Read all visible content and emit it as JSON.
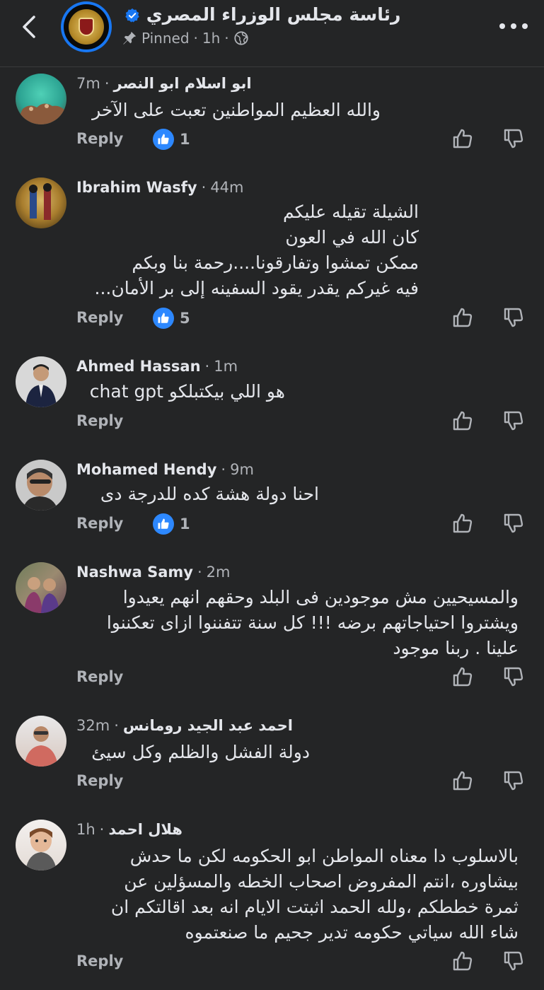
{
  "header": {
    "page_name": "رئاسة مجلس الوزراء المصري",
    "pinned_label": "Pinned",
    "time": "1h",
    "icons": {
      "back": "back-chevron-icon",
      "verified": "verified-badge-icon",
      "pin": "pin-icon",
      "globe": "globe-icon",
      "more": "more-dots-icon"
    }
  },
  "ui": {
    "reply_label": "Reply",
    "like_color": "#2d88ff"
  },
  "comments": [
    {
      "author": "ابو اسلام ابو النصر",
      "time": "7m",
      "text": [
        "والله العظيم المواطنين تعبت على الآخر"
      ],
      "reactions": "1"
    },
    {
      "author": "Ibrahim Wasfy",
      "time": "44m",
      "text": [
        "الشيلة تقيله عليكم",
        "كان الله في العون",
        "ممكن تمشوا وتفارقونا....رحمة بنا وبكم",
        "فيه غيركم يقدر يقود السفينه إلى بر الأمان..."
      ],
      "reactions": "5"
    },
    {
      "author": "Ahmed Hassan",
      "time": "1m",
      "text": [
        "هو اللي بيكتبلكو chat gpt"
      ],
      "reactions": ""
    },
    {
      "author": "Mohamed Hendy",
      "time": "9m",
      "text": [
        "احنا دولة هشة كده للدرجة دى"
      ],
      "reactions": "1"
    },
    {
      "author": "Nashwa Samy",
      "time": "2m",
      "text": [
        "والمسيحيين مش موجودين فى البلد وحقهم انهم يعيدوا",
        "ويشتروا احتياجاتهم برضه !!! كل سنة تتفننوا ازاى تعكننوا",
        "علينا . ربنا موجود"
      ],
      "reactions": ""
    },
    {
      "author": "احمد عبد الجيد رومانس",
      "time": "32m",
      "text": [
        "دولة الفشل والظلم وكل سيئ"
      ],
      "reactions": ""
    },
    {
      "author": "هلال احمد",
      "time": "1h",
      "text": [
        "بالاسلوب دا معناه المواطن ابو الحكومه لكن ما حدش",
        "بيشاوره ،انتم المفروض اصحاب الخطه والمسؤلين عن",
        "ثمرة خططكم ،ولله الحمد اثبتت الايام انه بعد اقالتكم ان",
        "شاء الله سياتي حكومه تدير جحيم ما صنعتموه"
      ],
      "reactions": ""
    }
  ]
}
